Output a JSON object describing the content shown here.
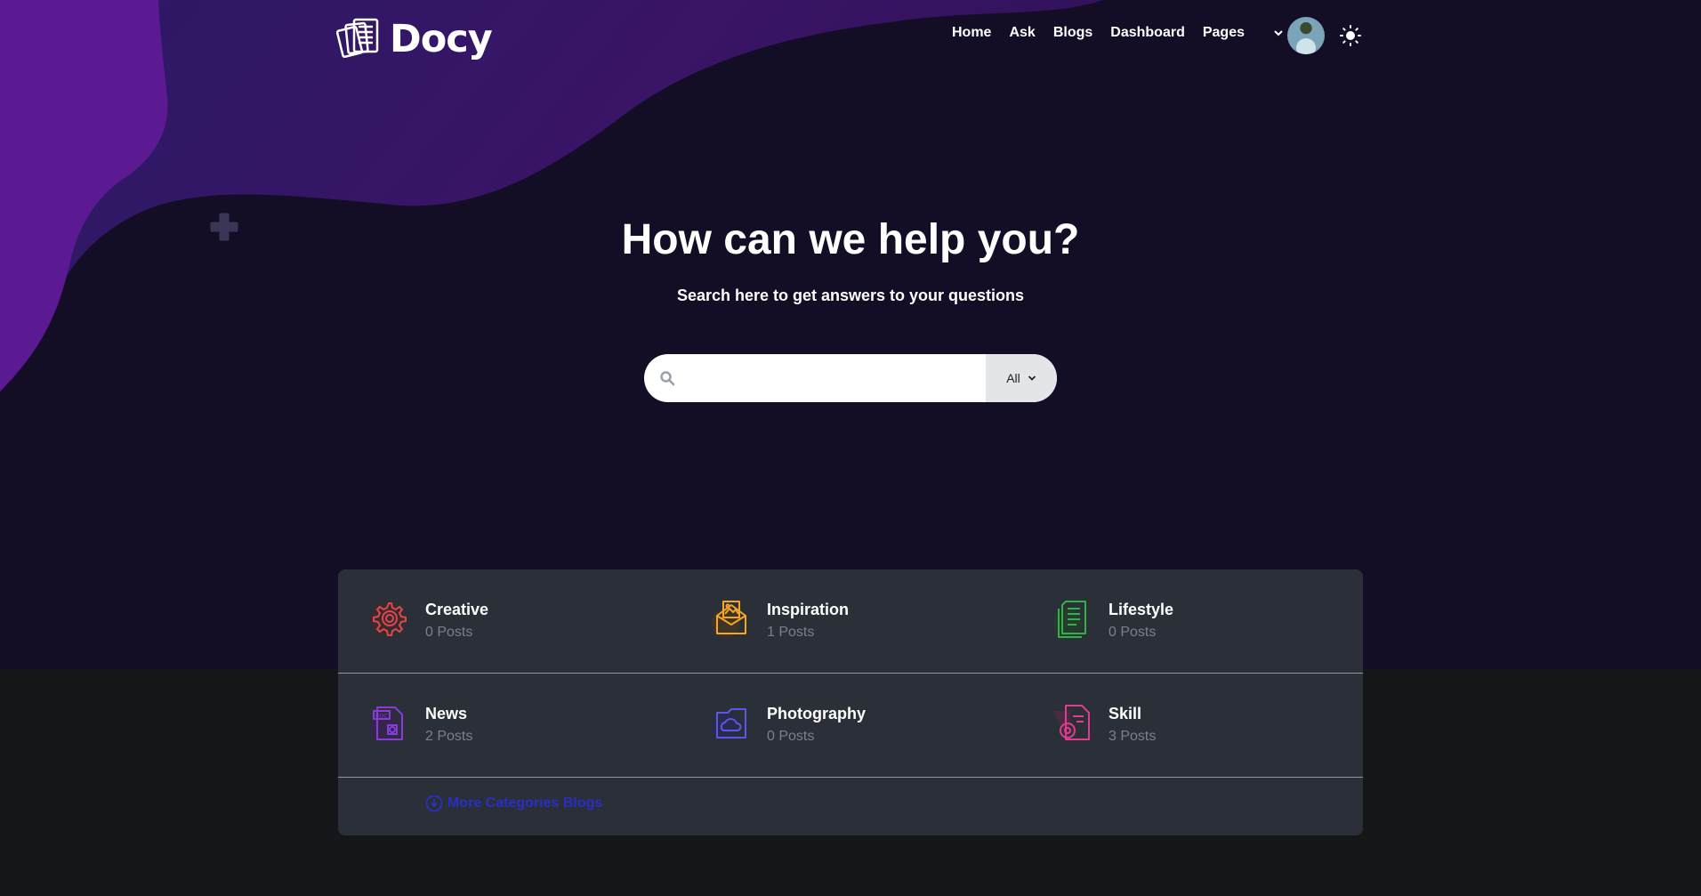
{
  "brand": {
    "name": "Docy"
  },
  "nav": {
    "items": [
      {
        "label": "Home"
      },
      {
        "label": "Ask"
      },
      {
        "label": "Blogs"
      },
      {
        "label": "Dashboard"
      },
      {
        "label": "Pages"
      }
    ]
  },
  "hero": {
    "title": "How can we help you?",
    "subtitle": "Search here to get answers to your questions"
  },
  "search": {
    "placeholder": "",
    "value": "",
    "filter_selected": "All"
  },
  "categories": [
    {
      "name": "Creative",
      "count": "0 Posts",
      "icon": "gear-icon",
      "color": "#e0474c"
    },
    {
      "name": "Inspiration",
      "count": "1 Posts",
      "icon": "mail-image-icon",
      "color": "#f5a623"
    },
    {
      "name": "Lifestyle",
      "count": "0 Posts",
      "icon": "document-icon",
      "color": "#2fb344"
    },
    {
      "name": "News",
      "count": "2 Posts",
      "icon": "doc-file-icon",
      "color": "#8a3ad8"
    },
    {
      "name": "Photography",
      "count": "0 Posts",
      "icon": "cloud-folder-icon",
      "color": "#5b58e8"
    },
    {
      "name": "Skill",
      "count": "3 Posts",
      "icon": "doc-gear-icon",
      "color": "#e23b8f"
    }
  ],
  "more_link": {
    "label": "More Categories Blogs"
  },
  "colors": {
    "hero_bg": "#130e25",
    "accent_purple": "#5e1a8f",
    "card_bg": "#2b2f37",
    "page_bg": "#141619",
    "link_blue": "#2a2ec7"
  }
}
